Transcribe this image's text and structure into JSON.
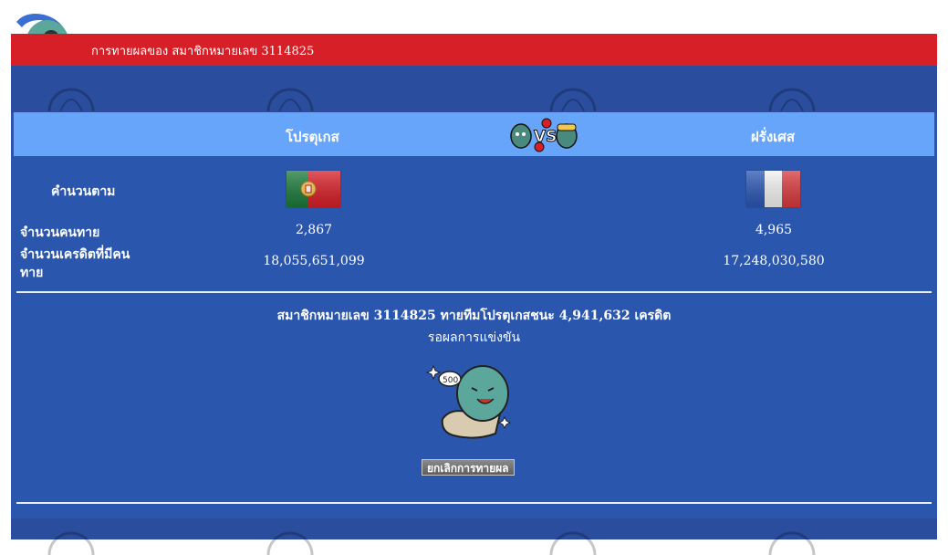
{
  "header": {
    "title": "การทายผลของ สมาชิกหมายเลข 3114825"
  },
  "match": {
    "team_left": "โปรตุเกส",
    "team_right": "ฝรั่งเศส",
    "vs_text": "VS"
  },
  "rows": {
    "row_heading": "คำนวนตาม",
    "predictors_label": "จำนวนคนทาย",
    "credits_label_line1": "จำนวนเครดิตที่มีคน",
    "credits_label_line2": "ทาย",
    "left_predictors": "2,867",
    "right_predictors": "4,965",
    "left_credits": "18,055,651,099",
    "right_credits": "17,248,030,580"
  },
  "result": {
    "message": "สมาชิกหมายเลข 3114825 ทายทีมโปรตุเกสชนะ 4,941,632 เครดิต",
    "status": "รอผลการแข่งขัน",
    "cancel_button": "ยกเลิกการทายผล"
  },
  "colors": {
    "header_red": "#d71f27",
    "panel_blue": "#2b56ad",
    "header_row_blue": "#66a5f9"
  }
}
